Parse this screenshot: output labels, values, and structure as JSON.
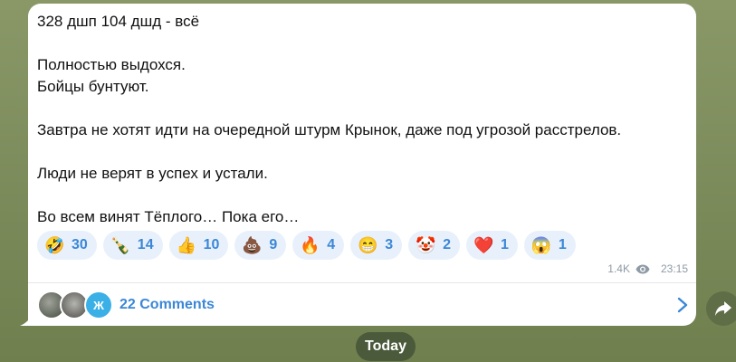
{
  "message": {
    "lines": [
      "328 дшп 104 дшд - всё",
      "",
      "Полностью выдохся.",
      "Бойцы бунтуют.",
      "",
      "Завтра не хотят идти на очередной штурм Крынок, даже под угрозой расстрелов.",
      "",
      "Люди не верят в успех и устали.",
      "",
      "Во всем винят Тёплого… Пока его…"
    ],
    "reactions": [
      {
        "emoji": "🤣",
        "count": "30"
      },
      {
        "emoji": "🍾",
        "count": "14"
      },
      {
        "emoji": "👍",
        "count": "10"
      },
      {
        "emoji": "💩",
        "count": "9"
      },
      {
        "emoji": "🔥",
        "count": "4"
      },
      {
        "emoji": "😁",
        "count": "3"
      },
      {
        "emoji": "🤡",
        "count": "2"
      },
      {
        "emoji": "❤️",
        "count": "1"
      },
      {
        "emoji": "😱",
        "count": "1"
      }
    ],
    "views": "1.4K",
    "time": "23:15"
  },
  "comments": {
    "avatar_letter": "Ж",
    "label": "22 Comments"
  },
  "date_separator": "Today",
  "colors": {
    "accent": "#3b87d6",
    "reaction_bg": "#e8f1fb",
    "bubble": "#ffffff",
    "background": "#7b8a5c"
  }
}
